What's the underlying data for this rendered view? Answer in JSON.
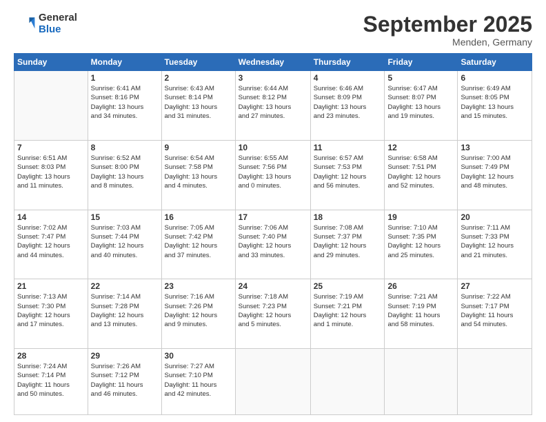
{
  "logo": {
    "general": "General",
    "blue": "Blue"
  },
  "header": {
    "month": "September 2025",
    "location": "Menden, Germany"
  },
  "weekdays": [
    "Sunday",
    "Monday",
    "Tuesday",
    "Wednesday",
    "Thursday",
    "Friday",
    "Saturday"
  ],
  "weeks": [
    [
      {
        "day": null,
        "info": null
      },
      {
        "day": "1",
        "info": "Sunrise: 6:41 AM\nSunset: 8:16 PM\nDaylight: 13 hours\nand 34 minutes."
      },
      {
        "day": "2",
        "info": "Sunrise: 6:43 AM\nSunset: 8:14 PM\nDaylight: 13 hours\nand 31 minutes."
      },
      {
        "day": "3",
        "info": "Sunrise: 6:44 AM\nSunset: 8:12 PM\nDaylight: 13 hours\nand 27 minutes."
      },
      {
        "day": "4",
        "info": "Sunrise: 6:46 AM\nSunset: 8:09 PM\nDaylight: 13 hours\nand 23 minutes."
      },
      {
        "day": "5",
        "info": "Sunrise: 6:47 AM\nSunset: 8:07 PM\nDaylight: 13 hours\nand 19 minutes."
      },
      {
        "day": "6",
        "info": "Sunrise: 6:49 AM\nSunset: 8:05 PM\nDaylight: 13 hours\nand 15 minutes."
      }
    ],
    [
      {
        "day": "7",
        "info": "Sunrise: 6:51 AM\nSunset: 8:03 PM\nDaylight: 13 hours\nand 11 minutes."
      },
      {
        "day": "8",
        "info": "Sunrise: 6:52 AM\nSunset: 8:00 PM\nDaylight: 13 hours\nand 8 minutes."
      },
      {
        "day": "9",
        "info": "Sunrise: 6:54 AM\nSunset: 7:58 PM\nDaylight: 13 hours\nand 4 minutes."
      },
      {
        "day": "10",
        "info": "Sunrise: 6:55 AM\nSunset: 7:56 PM\nDaylight: 13 hours\nand 0 minutes."
      },
      {
        "day": "11",
        "info": "Sunrise: 6:57 AM\nSunset: 7:53 PM\nDaylight: 12 hours\nand 56 minutes."
      },
      {
        "day": "12",
        "info": "Sunrise: 6:58 AM\nSunset: 7:51 PM\nDaylight: 12 hours\nand 52 minutes."
      },
      {
        "day": "13",
        "info": "Sunrise: 7:00 AM\nSunset: 7:49 PM\nDaylight: 12 hours\nand 48 minutes."
      }
    ],
    [
      {
        "day": "14",
        "info": "Sunrise: 7:02 AM\nSunset: 7:47 PM\nDaylight: 12 hours\nand 44 minutes."
      },
      {
        "day": "15",
        "info": "Sunrise: 7:03 AM\nSunset: 7:44 PM\nDaylight: 12 hours\nand 40 minutes."
      },
      {
        "day": "16",
        "info": "Sunrise: 7:05 AM\nSunset: 7:42 PM\nDaylight: 12 hours\nand 37 minutes."
      },
      {
        "day": "17",
        "info": "Sunrise: 7:06 AM\nSunset: 7:40 PM\nDaylight: 12 hours\nand 33 minutes."
      },
      {
        "day": "18",
        "info": "Sunrise: 7:08 AM\nSunset: 7:37 PM\nDaylight: 12 hours\nand 29 minutes."
      },
      {
        "day": "19",
        "info": "Sunrise: 7:10 AM\nSunset: 7:35 PM\nDaylight: 12 hours\nand 25 minutes."
      },
      {
        "day": "20",
        "info": "Sunrise: 7:11 AM\nSunset: 7:33 PM\nDaylight: 12 hours\nand 21 minutes."
      }
    ],
    [
      {
        "day": "21",
        "info": "Sunrise: 7:13 AM\nSunset: 7:30 PM\nDaylight: 12 hours\nand 17 minutes."
      },
      {
        "day": "22",
        "info": "Sunrise: 7:14 AM\nSunset: 7:28 PM\nDaylight: 12 hours\nand 13 minutes."
      },
      {
        "day": "23",
        "info": "Sunrise: 7:16 AM\nSunset: 7:26 PM\nDaylight: 12 hours\nand 9 minutes."
      },
      {
        "day": "24",
        "info": "Sunrise: 7:18 AM\nSunset: 7:23 PM\nDaylight: 12 hours\nand 5 minutes."
      },
      {
        "day": "25",
        "info": "Sunrise: 7:19 AM\nSunset: 7:21 PM\nDaylight: 12 hours\nand 1 minute."
      },
      {
        "day": "26",
        "info": "Sunrise: 7:21 AM\nSunset: 7:19 PM\nDaylight: 11 hours\nand 58 minutes."
      },
      {
        "day": "27",
        "info": "Sunrise: 7:22 AM\nSunset: 7:17 PM\nDaylight: 11 hours\nand 54 minutes."
      }
    ],
    [
      {
        "day": "28",
        "info": "Sunrise: 7:24 AM\nSunset: 7:14 PM\nDaylight: 11 hours\nand 50 minutes."
      },
      {
        "day": "29",
        "info": "Sunrise: 7:26 AM\nSunset: 7:12 PM\nDaylight: 11 hours\nand 46 minutes."
      },
      {
        "day": "30",
        "info": "Sunrise: 7:27 AM\nSunset: 7:10 PM\nDaylight: 11 hours\nand 42 minutes."
      },
      {
        "day": null,
        "info": null
      },
      {
        "day": null,
        "info": null
      },
      {
        "day": null,
        "info": null
      },
      {
        "day": null,
        "info": null
      }
    ]
  ]
}
